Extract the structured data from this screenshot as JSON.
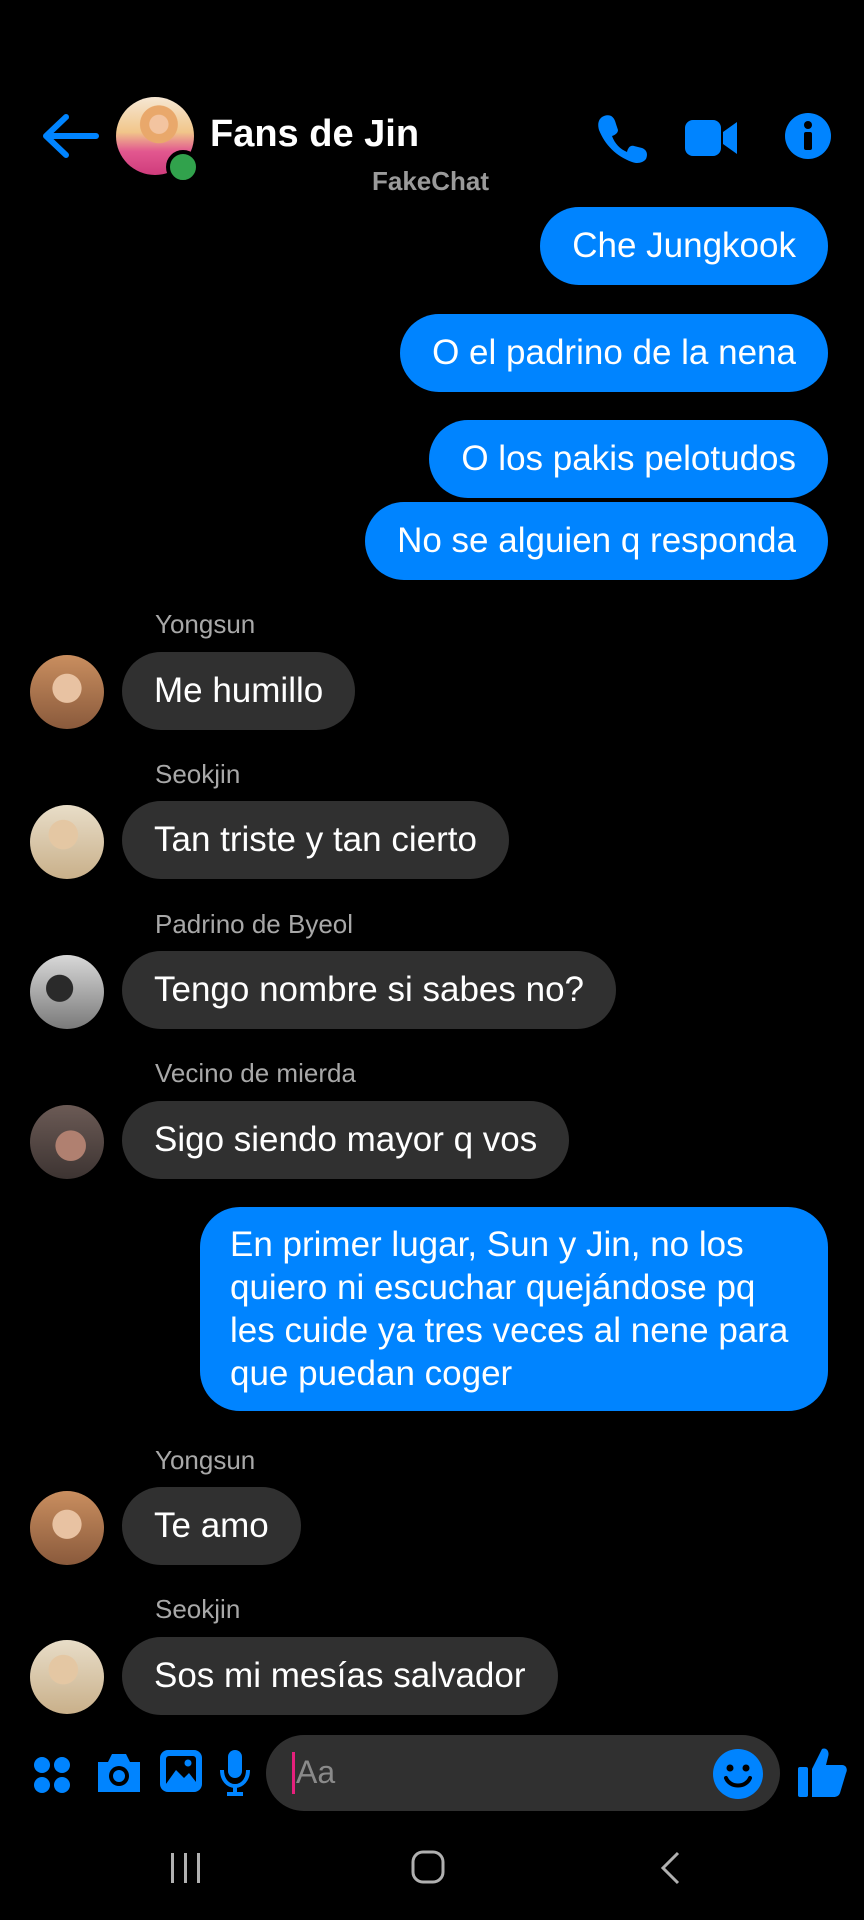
{
  "header": {
    "title": "Fans de Jin",
    "watermark": "FakeChat",
    "accent": "#0084ff",
    "icons": [
      "back-arrow-icon",
      "phone-icon",
      "video-camera-icon",
      "info-icon"
    ]
  },
  "messages": {
    "m1": "Che Jungkook",
    "m2": "O el padrino de la nena",
    "m3": "O los pakis pelotudos",
    "m4": "No se alguien q responda",
    "n5": "Yongsun",
    "m5": "Me humillo",
    "n6": "Seokjin",
    "m6": "Tan triste y tan cierto",
    "n7": "Padrino de Byeol",
    "m7": "Tengo nombre si sabes no?",
    "n8": "Vecino de mierda",
    "m8": "Sigo siendo mayor q vos",
    "m9": "En primer lugar, Sun y Jin, no los quiero ni escuchar quejándose pq les cuide ya tres veces al nene para que puedan coger",
    "n10": "Yongsun",
    "m10": "Te amo",
    "n11": "Seokjin",
    "m11": "Sos mi mesías salvador"
  },
  "composer": {
    "placeholder": "Aa",
    "icons": [
      "apps-icon",
      "camera-icon",
      "gallery-icon",
      "microphone-icon",
      "emoji-icon",
      "thumbs-up-icon"
    ]
  },
  "navbar": {
    "icons": [
      "recent-apps-icon",
      "home-icon",
      "back-icon"
    ]
  }
}
